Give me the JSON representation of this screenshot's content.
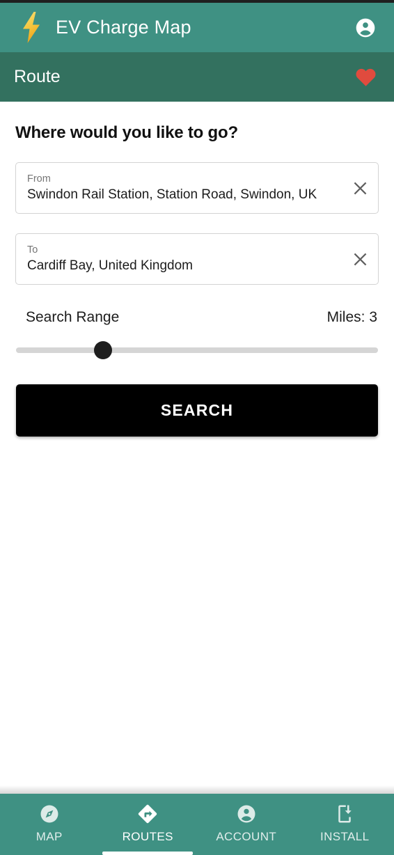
{
  "app": {
    "title": "EV Charge Map",
    "logo_icon": "lightning-bolt-icon",
    "account_icon": "account-circle-icon"
  },
  "subheader": {
    "title": "Route",
    "favorite_icon": "heart-icon"
  },
  "main": {
    "heading": "Where would you like to go?",
    "fields": [
      {
        "label": "From",
        "value": "Swindon Rail Station, Station Road, Swindon, UK",
        "clear_icon": "close-icon"
      },
      {
        "label": "To",
        "value": "Cardiff Bay, United Kingdom",
        "clear_icon": "close-icon"
      }
    ],
    "range": {
      "label": "Search Range",
      "value_label": "Miles: 3",
      "value": 3,
      "min": 0,
      "max": 12,
      "percent": 24
    },
    "search_button": "SEARCH"
  },
  "bottom_nav": {
    "items": [
      {
        "label": "MAP",
        "icon": "compass-icon",
        "active": false
      },
      {
        "label": "ROUTES",
        "icon": "route-sign-icon",
        "active": true
      },
      {
        "label": "ACCOUNT",
        "icon": "account-circle-icon",
        "active": false
      },
      {
        "label": "INSTALL",
        "icon": "phone-download-icon",
        "active": false
      }
    ]
  },
  "colors": {
    "app_bar": "#3f9183",
    "sub_bar": "#33715f",
    "heart": "#e04b3e",
    "bolt_top": "#f7dc6f",
    "bolt_bottom": "#f0a91e",
    "button": "#000000",
    "slider_track": "#d5d5d5",
    "slider_thumb": "#1e1e1e"
  }
}
